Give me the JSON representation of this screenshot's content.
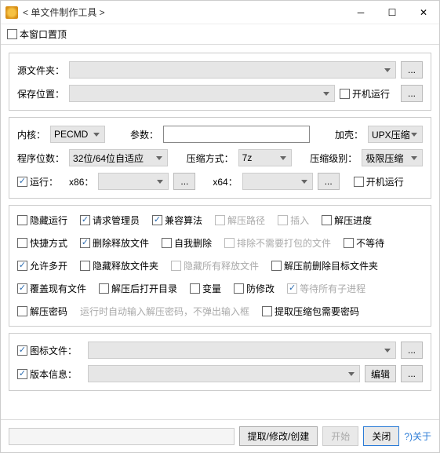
{
  "title": "< 单文件制作工具 >",
  "topbar": {
    "pin_label": "本窗口置顶",
    "pin_checked": false
  },
  "source": {
    "folder_label": "源文件夹：",
    "folder_value": "",
    "browse": "...",
    "save_label": "保存位置：",
    "save_value": "",
    "autorun_label": "开机运行",
    "autorun_checked": false
  },
  "core": {
    "kernel_label": "内核：",
    "kernel_value": "PECMD",
    "param_label": "参数：",
    "param_value": "",
    "shell_label": "加壳：",
    "shell_value": "UPX压缩",
    "bits_label": "程序位数：",
    "bits_value": "32位/64位自适应",
    "method_label": "压缩方式：",
    "method_value": "7z",
    "level_label": "压缩级别：",
    "level_value": "极限压缩",
    "run_label": "运行：",
    "run_checked": true,
    "x86_label": "x86：",
    "x86_value": "",
    "x64_label": "x64：",
    "x64_value": "",
    "autorun_label": "开机运行",
    "autorun_checked": false
  },
  "opts": {
    "hide_run": "隐藏运行",
    "req_admin": "请求管理员",
    "compat_alg": "兼容算法",
    "extract_path": "解压路径",
    "insert": "插入",
    "extract_progress": "解压进度",
    "shortcut": "快捷方式",
    "del_release": "删除释放文件",
    "self_del": "自我删除",
    "exclude_pack": "排除不需要打包的文件",
    "no_wait": "不等待",
    "multi_open": "允许多开",
    "hide_release_dir": "隐藏释放文件夹",
    "hide_all_release": "隐藏所有释放文件",
    "del_target_before": "解压前删除目标文件夹",
    "overwrite": "覆盖现有文件",
    "open_dir_after": "解压后打开目录",
    "variable": "变量",
    "anti_mod": "防修改",
    "wait_children": "等待所有子进程",
    "extract_pwd": "解压密码",
    "auto_pwd_note": "运行时自动输入解压密码，不弹出输入框",
    "get_pkg_pwd": "提取压缩包需要密码"
  },
  "opts_state": {
    "hide_run": false,
    "req_admin": true,
    "compat_alg": true,
    "extract_path": false,
    "insert": false,
    "extract_progress": false,
    "shortcut": false,
    "del_release": true,
    "self_del": false,
    "exclude_pack": false,
    "no_wait": false,
    "multi_open": true,
    "hide_release_dir": false,
    "hide_all_release": false,
    "del_target_before": false,
    "overwrite": true,
    "open_dir_after": false,
    "variable": false,
    "anti_mod": false,
    "wait_children": true,
    "extract_pwd": false,
    "get_pkg_pwd": false
  },
  "disabled_opts": [
    "extract_path",
    "insert",
    "exclude_pack",
    "hide_all_release",
    "wait_children"
  ],
  "icon": {
    "icon_label": "图标文件：",
    "icon_checked": true,
    "icon_value": "",
    "ver_label": "版本信息：",
    "ver_checked": true,
    "ver_value": "",
    "edit_btn": "编辑",
    "browse": "..."
  },
  "bottom": {
    "extract": "提取/修改/创建",
    "start": "开始",
    "close": "关闭",
    "about": "?)关于"
  },
  "win_btns": {
    "min": "─",
    "max": "☐",
    "close": "✕"
  }
}
